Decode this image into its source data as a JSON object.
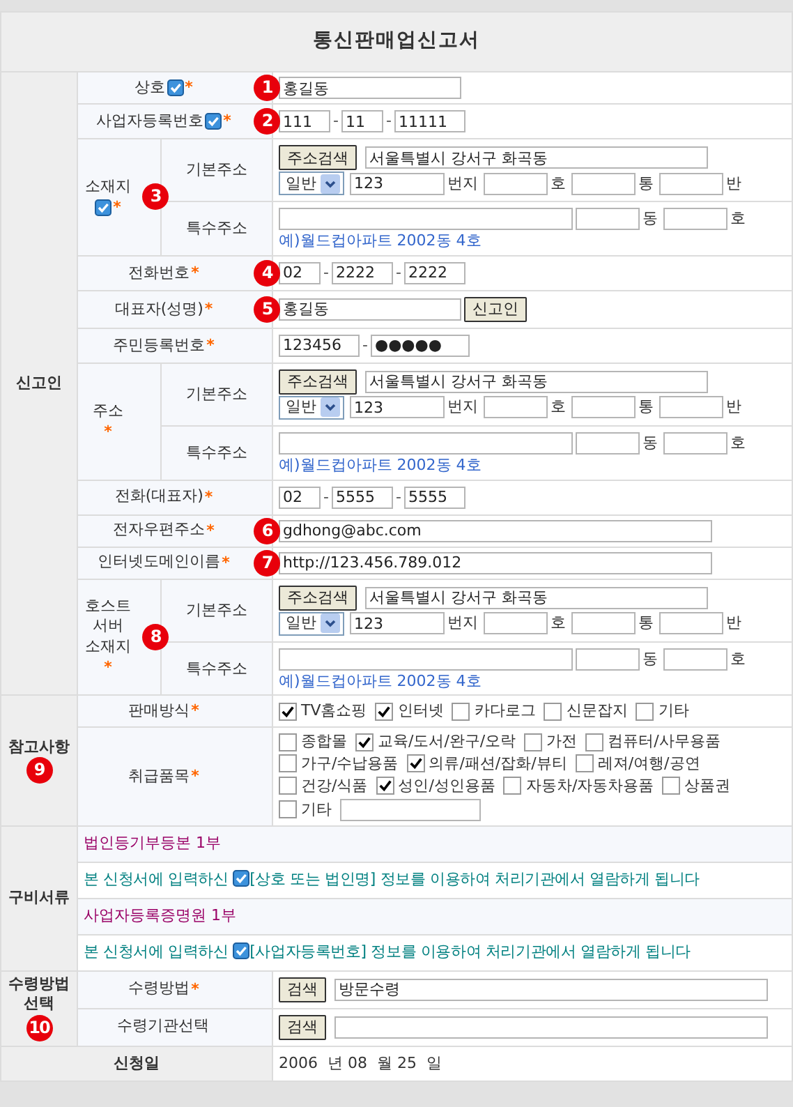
{
  "title": "통신판매업신고서",
  "sections": [
    {
      "kind": "group",
      "label": [
        "신고인"
      ],
      "rows": [
        {
          "kind": "text",
          "label": "상호",
          "check_icon": true,
          "mark": "*",
          "badge": "1",
          "value": "홍길동"
        },
        {
          "kind": "split",
          "label": "사업자등록번호",
          "check_icon": true,
          "mark": "*",
          "badge": "2",
          "separator": "-",
          "values": [
            "111",
            "11",
            "11111"
          ]
        },
        {
          "kind": "address",
          "label": [
            "소재지"
          ],
          "check_icon": true,
          "mark": "*",
          "badge": "3",
          "basic": {
            "label": "기본주소",
            "button": "주소검색",
            "value": "서울특별시 강서구 화곡동",
            "select": "일반",
            "number": "123",
            "units": [
              "번지",
              "호",
              "통",
              "반"
            ]
          },
          "special": {
            "label": "특수주소",
            "units": [
              "동",
              "호"
            ],
            "example": "예)월드컵아파트 2002동 4호"
          }
        },
        {
          "kind": "split",
          "label": "전화번호",
          "mark": "*",
          "badge": "4",
          "separator": "-",
          "values": [
            "02",
            "2222",
            "2222"
          ]
        },
        {
          "kind": "text_button",
          "label": "대표자(성명)",
          "mark": "*",
          "badge": "5",
          "value": "홍길동",
          "button": "신고인"
        },
        {
          "kind": "split",
          "label": "주민등록번호",
          "mark": "*",
          "separator": "-",
          "values": [
            "123456",
            "●●●●●"
          ]
        },
        {
          "kind": "address",
          "label": [
            "주소"
          ],
          "mark": "*",
          "basic": {
            "label": "기본주소",
            "button": "주소검색",
            "value": "서울특별시 강서구 화곡동",
            "select": "일반",
            "number": "123",
            "units": [
              "번지",
              "호",
              "통",
              "반"
            ]
          },
          "special": {
            "label": "특수주소",
            "units": [
              "동",
              "호"
            ],
            "example": "예)월드컵아파트 2002동 4호"
          }
        },
        {
          "kind": "split",
          "label": "전화(대표자)",
          "mark": "*",
          "separator": "-",
          "values": [
            "02",
            "5555",
            "5555"
          ]
        },
        {
          "kind": "text_long",
          "label": "전자우편주소",
          "mark": "*",
          "badge": "6",
          "value": "gdhong@abc.com"
        },
        {
          "kind": "text_long",
          "label": "인터넷도메인이름",
          "mark": "*",
          "badge": "7",
          "value": "http://123.456.789.012"
        },
        {
          "kind": "address",
          "label": [
            "호스트",
            "서버",
            "소재지"
          ],
          "mark": "*",
          "badge": "8",
          "basic": {
            "label": "기본주소",
            "button": "주소검색",
            "value": "서울특별시 강서구 화곡동",
            "select": "일반",
            "number": "123",
            "units": [
              "번지",
              "호",
              "통",
              "반"
            ]
          },
          "special": {
            "label": "특수주소",
            "units": [
              "동",
              "호"
            ],
            "example": "예)월드컵아파트 2002동 4호"
          }
        }
      ]
    },
    {
      "kind": "group",
      "label": [
        "참고사항"
      ],
      "badge": "9",
      "rows": [
        {
          "kind": "checks",
          "label": "판매방식",
          "mark": "*",
          "options": [
            {
              "label": "TV홈쇼핑",
              "checked": true
            },
            {
              "label": "인터넷",
              "checked": true
            },
            {
              "label": "카다로그",
              "checked": false
            },
            {
              "label": "신문잡지",
              "checked": false
            },
            {
              "label": "기타",
              "checked": false
            }
          ]
        },
        {
          "kind": "checks_other",
          "label": "취급품목",
          "mark": "*",
          "options": [
            {
              "label": "종합몰",
              "checked": false
            },
            {
              "label": "교육/도서/완구/오락",
              "checked": true
            },
            {
              "label": "가전",
              "checked": false
            },
            {
              "label": "컴퓨터/사무용품",
              "checked": false
            },
            {
              "label": "가구/수납용품",
              "checked": false
            },
            {
              "label": "의류/패션/잡화/뷰티",
              "checked": true
            },
            {
              "label": "레져/여행/공연",
              "checked": false
            },
            {
              "label": "건강/식품",
              "checked": false
            },
            {
              "label": "성인/성인용품",
              "checked": true
            },
            {
              "label": "자동차/자동차용품",
              "checked": false
            },
            {
              "label": "상품권",
              "checked": false
            },
            {
              "label": "기타",
              "checked": false
            }
          ]
        }
      ]
    },
    {
      "kind": "docs",
      "label": [
        "구비서류"
      ],
      "rows": [
        {
          "kind": "doc",
          "text": "법인등기부등본 1부"
        },
        {
          "kind": "note",
          "before": "본 신청서에 입력하신",
          "check_icon": true,
          "after": "[상호 또는 법인명] 정보를 이용하여 처리기관에서 열람하게 됩니다"
        },
        {
          "kind": "doc",
          "text": "사업자등록증명원 1부"
        },
        {
          "kind": "note",
          "before": "본 신청서에 입력하신",
          "check_icon": true,
          "after": "[사업자등록번호] 정보를 이용하여 처리기관에서 열람하게 됩니다"
        }
      ]
    },
    {
      "kind": "group",
      "label": [
        "수령방법",
        "선택"
      ],
      "badge": "10",
      "rows": [
        {
          "kind": "search",
          "label": "수령방법",
          "mark": "*",
          "button": "검색",
          "value": "방문수령"
        },
        {
          "kind": "search",
          "label": "수령기관선택",
          "button": "검색"
        }
      ]
    },
    {
      "kind": "date",
      "label": [
        "신청일"
      ],
      "value": "2006  년 08  월 25  일"
    }
  ]
}
